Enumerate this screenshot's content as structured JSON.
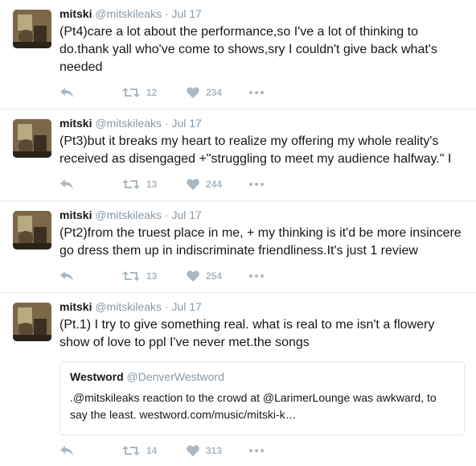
{
  "tweets": [
    {
      "name": "mitski",
      "handle": "@mitskileaks",
      "separator": "·",
      "date": "Jul 17",
      "text": "(Pt4)care a lot about the performance,so I've a lot of thinking to do.thank yall who've come to shows,sry I couldn't give back what's needed",
      "retweets": "12",
      "likes": "234"
    },
    {
      "name": "mitski",
      "handle": "@mitskileaks",
      "separator": "·",
      "date": "Jul 17",
      "text": "(Pt3)but it breaks my heart to realize my offering my whole reality's received as disengaged +\"struggling to meet my audience halfway.\" I",
      "retweets": "13",
      "likes": "244"
    },
    {
      "name": "mitski",
      "handle": "@mitskileaks",
      "separator": "·",
      "date": "Jul 17",
      "text": "(Pt2)from the truest place in me, + my thinking is it'd be more insincere go dress them up in indiscriminate friendliness.It's just 1 review",
      "retweets": "13",
      "likes": "254"
    },
    {
      "name": "mitski",
      "handle": "@mitskileaks",
      "separator": "·",
      "date": "Jul 17",
      "text": "(Pt.1) I try to give something real. what is real to me isn't a flowery show of love to ppl I've never met.the songs",
      "retweets": "14",
      "likes": "313",
      "quote": {
        "name": "Westword",
        "handle": "@DenverWestword",
        "text": ".@mitskileaks reaction to the crowd at @LarimerLounge was awkward, to say the least. westword.com/music/mitski-k…"
      }
    }
  ],
  "icons": {
    "reply": "reply-icon",
    "retweet": "retweet-icon",
    "like": "heart-icon",
    "more": "more-icon"
  },
  "colors": {
    "name": "#14171a",
    "meta": "#8899a6",
    "action": "#aab8c2",
    "border": "#e6ecf0"
  }
}
